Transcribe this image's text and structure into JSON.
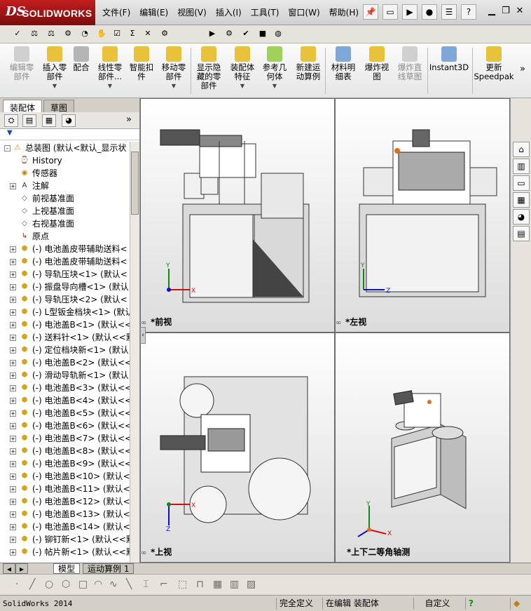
{
  "app": {
    "logo_prefix": "DS",
    "logo_name": "SOLIDWORKS",
    "menu": [
      "文件(F)",
      "编辑(E)",
      "视图(V)",
      "插入(I)",
      "工具(T)",
      "窗口(W)",
      "帮助(H)"
    ]
  },
  "command_manager": [
    {
      "label1": "编辑零",
      "label2": "部件",
      "disabled": true
    },
    {
      "label1": "插入零",
      "label2": "部件",
      "disabled": false
    },
    {
      "label1": "配合",
      "label2": "",
      "disabled": false
    },
    {
      "label1": "线性零",
      "label2": "部件...",
      "disabled": false
    },
    {
      "label1": "智能扣",
      "label2": "件",
      "disabled": false
    },
    {
      "label1": "移动零",
      "label2": "部件",
      "disabled": false
    },
    {
      "label1": "显示隐",
      "label2": "藏的零",
      "label3": "部件",
      "disabled": false
    },
    {
      "label1": "装配体",
      "label2": "特征",
      "disabled": false
    },
    {
      "label1": "参考几",
      "label2": "何体",
      "disabled": false
    },
    {
      "label1": "新建运",
      "label2": "动算例",
      "disabled": false
    },
    {
      "label1": "材料明",
      "label2": "细表",
      "disabled": false
    },
    {
      "label1": "爆炸视",
      "label2": "图",
      "disabled": false
    },
    {
      "label1": "爆炸直",
      "label2": "线草图",
      "disabled": true
    },
    {
      "label1": "Instant3D",
      "label2": "",
      "disabled": false
    },
    {
      "label1": "更新",
      "label2": "Speedpak",
      "disabled": false
    }
  ],
  "left_panel": {
    "tabs": [
      "装配体",
      "草图"
    ],
    "tree": [
      {
        "label": "总装图  (默认<默认_显示状",
        "icon": "assembly-icon",
        "expand": "-",
        "indent": 0
      },
      {
        "label": "History",
        "icon": "history-icon",
        "expand": "",
        "indent": 1
      },
      {
        "label": "传感器",
        "icon": "sensor-icon",
        "expand": "",
        "indent": 1
      },
      {
        "label": "注解",
        "icon": "annotation-icon",
        "expand": "+",
        "indent": 1
      },
      {
        "label": "前视基准面",
        "icon": "plane-icon",
        "expand": "",
        "indent": 1
      },
      {
        "label": "上视基准面",
        "icon": "plane-icon",
        "expand": "",
        "indent": 1
      },
      {
        "label": "右视基准面",
        "icon": "plane-icon",
        "expand": "",
        "indent": 1
      },
      {
        "label": "原点",
        "icon": "origin-icon",
        "expand": "",
        "indent": 1
      },
      {
        "label": "(-) 电池盖皮带辅助送料<",
        "icon": "part-icon",
        "expand": "+",
        "indent": 1
      },
      {
        "label": "(-) 电池盖皮带辅助送料<",
        "icon": "part-icon",
        "expand": "+",
        "indent": 1
      },
      {
        "label": "(-) 导轨压块<1> (默认<",
        "icon": "part-icon",
        "expand": "+",
        "indent": 1
      },
      {
        "label": "(-) 振盘导向槽<1> (默认",
        "icon": "part-icon",
        "expand": "+",
        "indent": 1
      },
      {
        "label": "(-) 导轨压块<2> (默认<",
        "icon": "part-icon",
        "expand": "+",
        "indent": 1
      },
      {
        "label": "(-) L型钣金档块<1> (默认",
        "icon": "part-icon",
        "expand": "+",
        "indent": 1
      },
      {
        "label": "(-) 电池盖B<1> (默认<<默",
        "icon": "part-icon",
        "expand": "+",
        "indent": 1
      },
      {
        "label": "(-) 送料针<1> (默认<<默",
        "icon": "part-icon",
        "expand": "+",
        "indent": 1
      },
      {
        "label": "(-) 定位档块新<1> (默认",
        "icon": "part-icon",
        "expand": "+",
        "indent": 1
      },
      {
        "label": "(-) 电池盖B<2> (默认<<",
        "icon": "part-icon",
        "expand": "+",
        "indent": 1
      },
      {
        "label": "(-) 滑动导轨新<1> (默认",
        "icon": "part-icon",
        "expand": "+",
        "indent": 1
      },
      {
        "label": "(-) 电池盖B<3> (默认<<",
        "icon": "part-icon",
        "expand": "+",
        "indent": 1
      },
      {
        "label": "(-) 电池盖B<4> (默认<<",
        "icon": "part-icon",
        "expand": "+",
        "indent": 1
      },
      {
        "label": "(-) 电池盖B<5> (默认<<",
        "icon": "part-icon",
        "expand": "+",
        "indent": 1
      },
      {
        "label": "(-) 电池盖B<6> (默认<<",
        "icon": "part-icon",
        "expand": "+",
        "indent": 1
      },
      {
        "label": "(-) 电池盖B<7> (默认<<",
        "icon": "part-icon",
        "expand": "+",
        "indent": 1
      },
      {
        "label": "(-) 电池盖B<8> (默认<<",
        "icon": "part-icon",
        "expand": "+",
        "indent": 1
      },
      {
        "label": "(-) 电池盖B<9> (默认<<",
        "icon": "part-icon",
        "expand": "+",
        "indent": 1
      },
      {
        "label": "(-) 电池盖B<10> (默认<<",
        "icon": "part-icon",
        "expand": "+",
        "indent": 1
      },
      {
        "label": "(-) 电池盖B<11> (默认<<",
        "icon": "part-icon",
        "expand": "+",
        "indent": 1
      },
      {
        "label": "(-) 电池盖B<12> (默认<<",
        "icon": "part-icon",
        "expand": "+",
        "indent": 1
      },
      {
        "label": "(-) 电池盖B<13> (默认<<",
        "icon": "part-icon",
        "expand": "+",
        "indent": 1
      },
      {
        "label": "(-) 电池盖B<14> (默认<<",
        "icon": "part-icon",
        "expand": "+",
        "indent": 1
      },
      {
        "label": "(-) 铆钉新<1> (默认<<默",
        "icon": "part-icon",
        "expand": "+",
        "indent": 1
      },
      {
        "label": "(-) 帖片新<1> (默认<<默",
        "icon": "part-icon",
        "expand": "+",
        "indent": 1
      }
    ]
  },
  "viewports": {
    "front": "*前视",
    "left": "*左视",
    "top": "*上视",
    "iso": "*上下二等角轴测"
  },
  "bottom_tabs": [
    "模型",
    "运动算例 1"
  ],
  "status": {
    "app_version": "SolidWorks 2014",
    "state": "完全定义",
    "mode": "在编辑 装配体",
    "units": "自定义"
  },
  "colors": {
    "logo_red": "#a81818",
    "axis_red": "#d01010",
    "axis_green": "#108a10",
    "axis_blue": "#1010d0"
  }
}
